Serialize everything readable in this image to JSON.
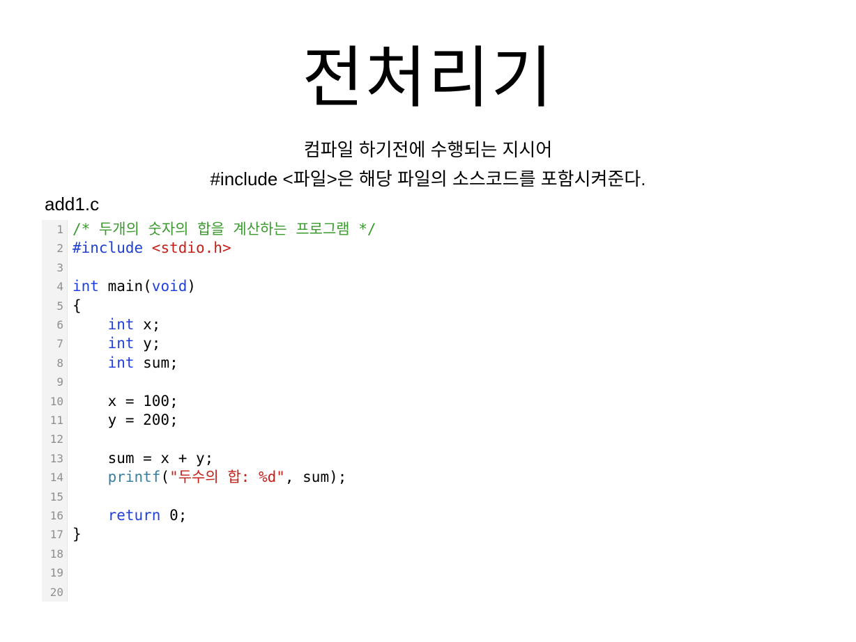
{
  "slide": {
    "title": "전처리기",
    "subtitle_line1": "컴파일 하기전에 수행되는 지시어",
    "subtitle_line2": "#include <파일>은 해당 파일의 소스코드를 포함시켜준다.",
    "file_name": "add1.c"
  },
  "colors": {
    "comment": "#3a9a2e",
    "preprocessor": "#1f3fcf",
    "string": "#c4211a",
    "keyword": "#2040e0",
    "function": "#3a7ea0",
    "plain": "#000000",
    "line_number": "#8e8e8e",
    "gutter_bg": "#f3f3f3"
  },
  "code": {
    "lines": [
      {
        "n": "1",
        "tokens": [
          {
            "t": "comment",
            "v": "/* 두개의 숫자의 합을 계산하는 프로그램 */"
          }
        ]
      },
      {
        "n": "2",
        "tokens": [
          {
            "t": "preproc",
            "v": "#include "
          },
          {
            "t": "string",
            "v": "<stdio.h>"
          }
        ]
      },
      {
        "n": "3",
        "tokens": []
      },
      {
        "n": "4",
        "tokens": [
          {
            "t": "keyword",
            "v": "int"
          },
          {
            "t": "plain",
            "v": " main("
          },
          {
            "t": "keyword",
            "v": "void"
          },
          {
            "t": "plain",
            "v": ")"
          }
        ]
      },
      {
        "n": "5",
        "tokens": [
          {
            "t": "plain",
            "v": "{"
          }
        ]
      },
      {
        "n": "6",
        "tokens": [
          {
            "t": "plain",
            "v": "    "
          },
          {
            "t": "keyword",
            "v": "int"
          },
          {
            "t": "plain",
            "v": " x;"
          }
        ]
      },
      {
        "n": "7",
        "tokens": [
          {
            "t": "plain",
            "v": "    "
          },
          {
            "t": "keyword",
            "v": "int"
          },
          {
            "t": "plain",
            "v": " y;"
          }
        ]
      },
      {
        "n": "8",
        "tokens": [
          {
            "t": "plain",
            "v": "    "
          },
          {
            "t": "keyword",
            "v": "int"
          },
          {
            "t": "plain",
            "v": " sum;"
          }
        ]
      },
      {
        "n": "9",
        "tokens": []
      },
      {
        "n": "10",
        "tokens": [
          {
            "t": "plain",
            "v": "    x = 100;"
          }
        ]
      },
      {
        "n": "11",
        "tokens": [
          {
            "t": "plain",
            "v": "    y = 200;"
          }
        ]
      },
      {
        "n": "12",
        "tokens": []
      },
      {
        "n": "13",
        "tokens": [
          {
            "t": "plain",
            "v": "    sum = x + y;"
          }
        ]
      },
      {
        "n": "14",
        "tokens": [
          {
            "t": "plain",
            "v": "    "
          },
          {
            "t": "func",
            "v": "printf"
          },
          {
            "t": "plain",
            "v": "("
          },
          {
            "t": "string",
            "v": "\"두수의 합: %d\""
          },
          {
            "t": "plain",
            "v": ", sum);"
          }
        ]
      },
      {
        "n": "15",
        "tokens": []
      },
      {
        "n": "16",
        "tokens": [
          {
            "t": "plain",
            "v": "    "
          },
          {
            "t": "keyword",
            "v": "return"
          },
          {
            "t": "plain",
            "v": " 0;"
          }
        ]
      },
      {
        "n": "17",
        "tokens": [
          {
            "t": "plain",
            "v": "}"
          }
        ]
      },
      {
        "n": "18",
        "tokens": []
      },
      {
        "n": "19",
        "tokens": []
      },
      {
        "n": "20",
        "tokens": []
      }
    ]
  }
}
